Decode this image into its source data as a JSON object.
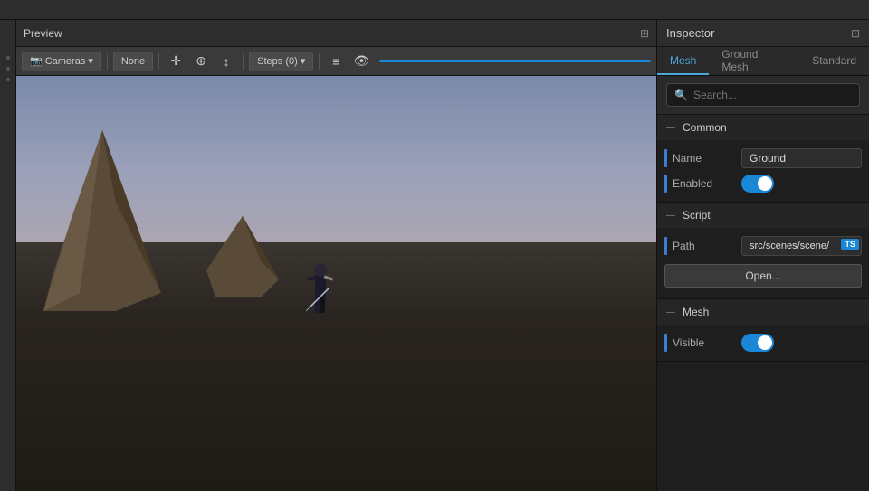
{
  "topbar": {
    "title": ""
  },
  "preview": {
    "title": "Preview",
    "toolbar": {
      "cameras_label": "Cameras",
      "none_label": "None",
      "steps_label": "Steps (0)"
    },
    "expand_icon": "⊞"
  },
  "inspector": {
    "title": "Inspector",
    "expand_icon": "⊡",
    "tabs": [
      {
        "id": "mesh",
        "label": "Mesh",
        "active": true
      },
      {
        "id": "ground-mesh",
        "label": "Ground Mesh",
        "active": false
      },
      {
        "id": "standard",
        "label": "Standard",
        "active": false
      }
    ],
    "search": {
      "placeholder": "Search..."
    },
    "sections": {
      "common": {
        "title": "Common",
        "props": {
          "name": {
            "label": "Name",
            "value": "Ground"
          },
          "enabled": {
            "label": "Enabled",
            "value": true
          }
        }
      },
      "script": {
        "title": "Script",
        "props": {
          "path": {
            "label": "Path",
            "value": "src/scenes/scene/",
            "badge": "TS"
          }
        },
        "open_button": "Open..."
      },
      "mesh": {
        "title": "Mesh",
        "props": {
          "visible": {
            "label": "Visible",
            "value": true
          }
        }
      }
    }
  },
  "icons": {
    "camera": "📷",
    "move": "✛",
    "rotate": "⊕",
    "scale": "↕",
    "menu": "≡",
    "eye": "👁",
    "search": "🔍",
    "collapse": "—",
    "expand": "⊞"
  }
}
